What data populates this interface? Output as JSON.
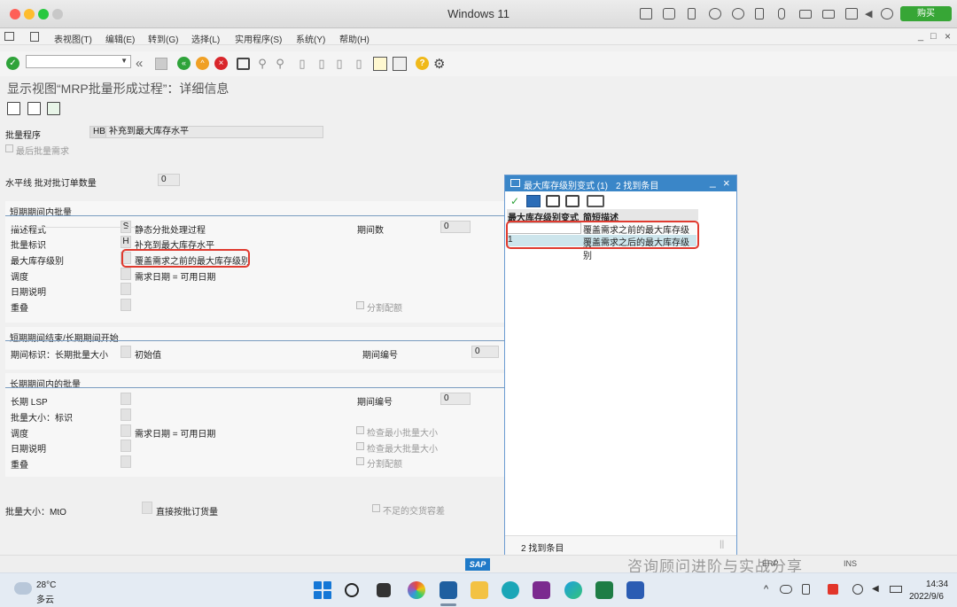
{
  "window": {
    "title": "Windows 11",
    "buy_label": "购买"
  },
  "menu": [
    "表视图(T)",
    "编辑(E)",
    "转到(G)",
    "选择(L)",
    "实用程序(S)",
    "系统(Y)",
    "帮助(H)"
  ],
  "page_title": "显示视图“MRP批量形成过程”：详细信息",
  "header": {
    "batch_program_label": "批量程序",
    "batch_program_code": "HB",
    "batch_program_text": "补充到最大库存水平",
    "last_batch_label": "最后批量需求",
    "horizon_label": "水平线 批对批订单数量",
    "horizon_value": "0"
  },
  "short_term": {
    "title": "短期期间内批量",
    "desc_proc_label": "描述程式",
    "desc_proc_code": "S",
    "desc_proc_text": "静态分批处理过程",
    "lot_id_label": "批量标识",
    "lot_id_code": "H",
    "lot_id_text": "补充到最大库存水平",
    "max_stock_label": "最大库存级别",
    "max_stock_text": "覆盖需求之前的最大库存级别",
    "schedule_label": "调度",
    "schedule_text": "需求日期 = 可用日期",
    "date_desc_label": "日期说明",
    "overlap_label": "重叠",
    "period_count_label": "期间数",
    "period_count_value": "0",
    "split_label": "分割配额"
  },
  "transition": {
    "title": "短期期间结束/长期期间开始",
    "period_id_label": "期间标识：长期批量大小",
    "period_id_text": "初始值",
    "period_no_label": "期间编号",
    "period_no_value": "0"
  },
  "long_term": {
    "title": "长期期间内的批量",
    "lsp_label": "长期 LSP",
    "lot_size_label": "批量大小：标识",
    "schedule_label": "调度",
    "schedule_text": "需求日期 = 可用日期",
    "date_desc_label": "日期说明",
    "overlap_label": "重叠",
    "period_no_label": "期间编号",
    "period_no_value": "0",
    "check_min_label": "检查最小批量大小",
    "check_max_label": "检查最大批量大小",
    "split_label": "分割配额"
  },
  "footer_fields": {
    "lot_size_label": "批量大小：MtO",
    "direct_label": "直接按批订货量",
    "shortage_label": "不足的交货容差"
  },
  "popup": {
    "title": "最大库存级别变式 (1)",
    "found_label": "2 找到条目",
    "col1": "最大库存级别变式",
    "col2": "简短描述",
    "rows": [
      {
        "variant": "",
        "desc": "覆盖需求之前的最大库存级别"
      },
      {
        "variant": "1",
        "desc": "覆盖需求之后的最大库存级别"
      }
    ],
    "status": "2 找到条目"
  },
  "statusbar": {
    "sap_logo": "SAP",
    "watermark": "咨询顾问进阶与实战分享",
    "sys1": "ERP",
    "sys2": "INS"
  },
  "taskbar": {
    "weather_temp": "28°C",
    "weather_text": "多云",
    "time": "14:34",
    "date": "2022/9/6"
  },
  "colors": {
    "sap_blue": "#3a86c8",
    "highlight": "#e03a2f",
    "green": "#37a636"
  }
}
